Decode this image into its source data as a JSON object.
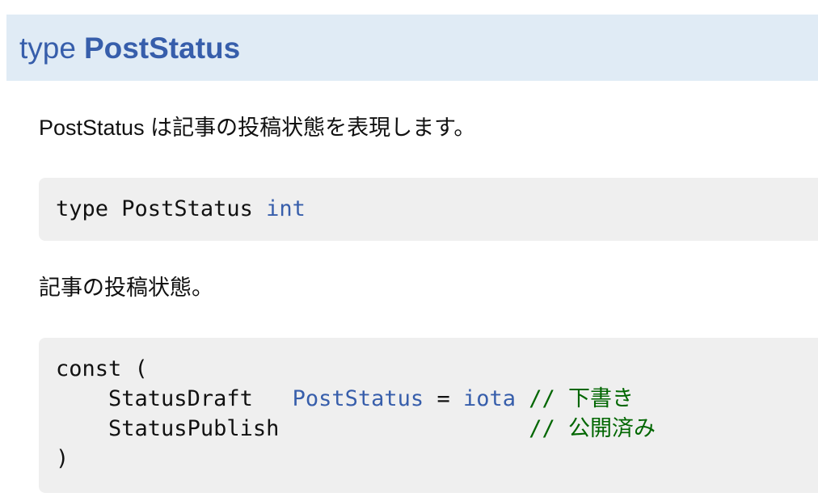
{
  "heading": {
    "keyword": "type",
    "name": "PostStatus"
  },
  "description": "PostStatus は記事の投稿状態を表現します。",
  "type_decl": {
    "keyword": "type",
    "name": "PostStatus",
    "underlying": "int"
  },
  "const_description": "記事の投稿状態。",
  "const_block": {
    "open": "const (",
    "close": ")",
    "items": [
      {
        "name": "StatusDraft",
        "type": "PostStatus",
        "assign": "=",
        "value": "iota",
        "comment": "// 下書き"
      },
      {
        "name": "StatusPublish",
        "comment": "// 公開済み"
      }
    ]
  },
  "colors": {
    "heading_bg": "#e0ebf5",
    "link_blue": "#375eab",
    "code_bg": "#efefef",
    "comment_green": "#006600"
  }
}
